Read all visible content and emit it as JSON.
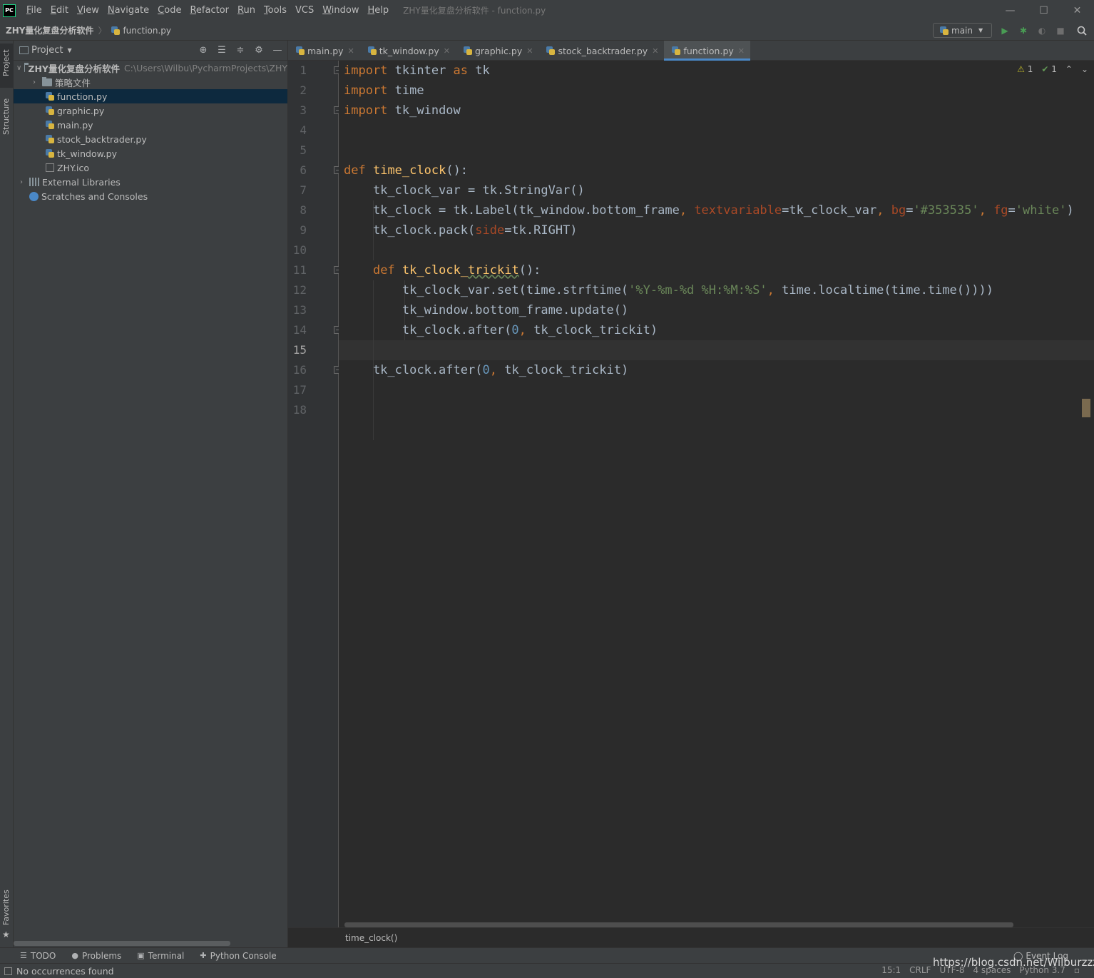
{
  "app": {
    "logo_text": "PC",
    "window_title": "ZHY量化复盘分析软件 - function.py",
    "menu": [
      {
        "mnemonic": "F",
        "rest": "ile"
      },
      {
        "mnemonic": "E",
        "rest": "dit"
      },
      {
        "mnemonic": "V",
        "rest": "iew"
      },
      {
        "mnemonic": "N",
        "rest": "avigate"
      },
      {
        "mnemonic": "C",
        "rest": "ode"
      },
      {
        "mnemonic": "R",
        "rest": "efactor"
      },
      {
        "mnemonic": "R",
        "rest": "un"
      },
      {
        "mnemonic": "T",
        "rest": "ools"
      },
      {
        "mnemonic": "",
        "rest": "VCS"
      },
      {
        "mnemonic": "W",
        "rest": "indow"
      },
      {
        "mnemonic": "H",
        "rest": "elp"
      }
    ],
    "window_controls": {
      "minimize": "—",
      "maximize": "☐",
      "close": "✕"
    }
  },
  "navbar": {
    "project": "ZHY量化复盘分析软件",
    "separator": "〉",
    "file": "function.py",
    "run_config": "main"
  },
  "left_stripe": {
    "project": "Project",
    "structure": "Structure",
    "favorites": "Favorites"
  },
  "project_panel": {
    "title": "Project",
    "root": {
      "name": "ZHY量化复盘分析软件",
      "path": "C:\\Users\\Wilbu\\PycharmProjects\\ZHY"
    },
    "items": [
      {
        "name": "策略文件",
        "type": "folder"
      },
      {
        "name": "function.py",
        "type": "py",
        "selected": true
      },
      {
        "name": "graphic.py",
        "type": "py"
      },
      {
        "name": "main.py",
        "type": "py"
      },
      {
        "name": "stock_backtrader.py",
        "type": "py"
      },
      {
        "name": "tk_window.py",
        "type": "py"
      },
      {
        "name": "ZHY.ico",
        "type": "ico"
      }
    ],
    "external_libraries": "External Libraries",
    "scratches": "Scratches and Consoles"
  },
  "tabs": [
    {
      "label": "main.py",
      "active": false
    },
    {
      "label": "tk_window.py",
      "active": false
    },
    {
      "label": "graphic.py",
      "active": false
    },
    {
      "label": "stock_backtrader.py",
      "active": false
    },
    {
      "label": "function.py",
      "active": true
    }
  ],
  "editor": {
    "line_numbers": [
      "1",
      "2",
      "3",
      "4",
      "5",
      "6",
      "7",
      "8",
      "9",
      "10",
      "11",
      "12",
      "13",
      "14",
      "15",
      "16",
      "17",
      "18"
    ],
    "current_line": 15,
    "inspections": {
      "warnings": "1",
      "weak": "1"
    },
    "breadcrumb": "time_clock()"
  },
  "bottom_tools": [
    {
      "icon": "todo-icon",
      "label": "TODO"
    },
    {
      "icon": "problems-icon",
      "label": "Problems"
    },
    {
      "icon": "terminal-icon",
      "label": "Terminal"
    },
    {
      "icon": "python-console-icon",
      "label": "Python Console"
    }
  ],
  "event_log": "Event Log",
  "status": {
    "message": "No occurrences found",
    "position": "15:1",
    "line_sep": "CRLF",
    "encoding": "UTF-8",
    "indent": "4 spaces",
    "interpreter": "Python 3.7"
  },
  "watermark": "https://blog.csdn.net/Wilburzzz"
}
